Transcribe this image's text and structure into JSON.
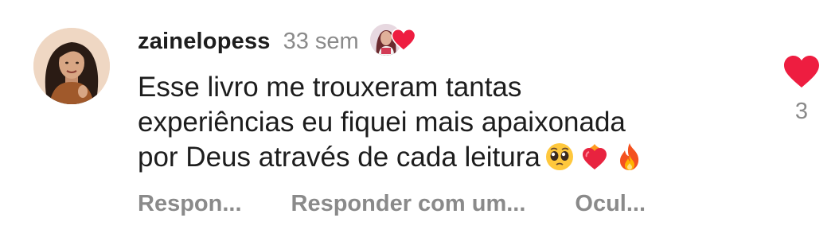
{
  "comment": {
    "author": "zainelopess",
    "timestamp": "33 sem",
    "text_lines": [
      "Esse livro me trouxeram tantas",
      "experiências eu fiquei mais apaixonada",
      "por Deus através de cada leitura"
    ],
    "emojis": [
      "pleading-face",
      "heart-on-fire",
      "fire"
    ],
    "like_count": "3",
    "liked_by_author_icon": "heart-icon"
  },
  "actions": {
    "reply_label": "Respon...",
    "reply_with_photo_label": "Responder com um...",
    "hide_label": "Ocul..."
  },
  "colors": {
    "heart": "#ee1d40",
    "muted_text": "#8a8a8a",
    "primary_text": "#1d1d1d"
  }
}
